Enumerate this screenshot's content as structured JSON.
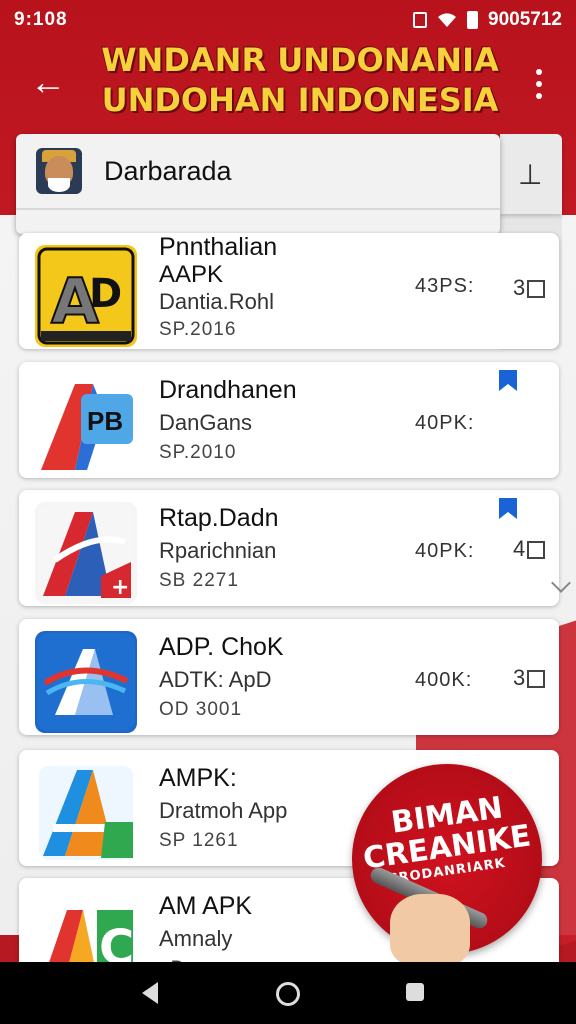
{
  "status_bar": {
    "time": "9:108",
    "right_text": "9005712",
    "icons": [
      "sim-icon",
      "wifi-icon",
      "battery-icon"
    ]
  },
  "header": {
    "title_line1": "WNDANR UNDONANIA",
    "title_line2": "UNDOHAN INDONESIA",
    "back_icon": "arrow-left-icon",
    "more_icon": "more-vertical-icon",
    "colors": {
      "title": "#f7d13b",
      "bar": "#c8202a"
    }
  },
  "search": {
    "value": "Darbarada",
    "side_icon": "sort-icon"
  },
  "apps": [
    {
      "name_line1": "Pnnthalian",
      "name_line2": "AAPK",
      "subtitle": "Dantia.Rohl",
      "date": "SP.2016",
      "size": "43PS:",
      "check": "3"
    },
    {
      "name_line1": "Drandhanen",
      "subtitle": "DanGans",
      "date": "SP.2010",
      "size": "40PK:"
    },
    {
      "name_line1": "Rtap.Dadn",
      "subtitle": "Rparichnian",
      "date": "SB 2271",
      "size": "40PK:",
      "check": "4"
    },
    {
      "name_line1": "ADP. ChoK",
      "subtitle": "ADTK: ApD",
      "date": "OD 3001",
      "size": "400K:",
      "check": "3"
    },
    {
      "name_line1": "AMPK:",
      "subtitle": "Dratmoh App",
      "date": "SP 1261"
    },
    {
      "name_line1": "AM APK",
      "subtitle": "Amnaly",
      "date": "oDanaman"
    }
  ],
  "promo": {
    "line1": "BIMAN",
    "line2": "CREANIKE",
    "line3": "CRODANRIARK"
  },
  "navbar": {
    "icons": [
      "nav-back-icon",
      "nav-home-icon",
      "nav-recent-icon"
    ]
  }
}
